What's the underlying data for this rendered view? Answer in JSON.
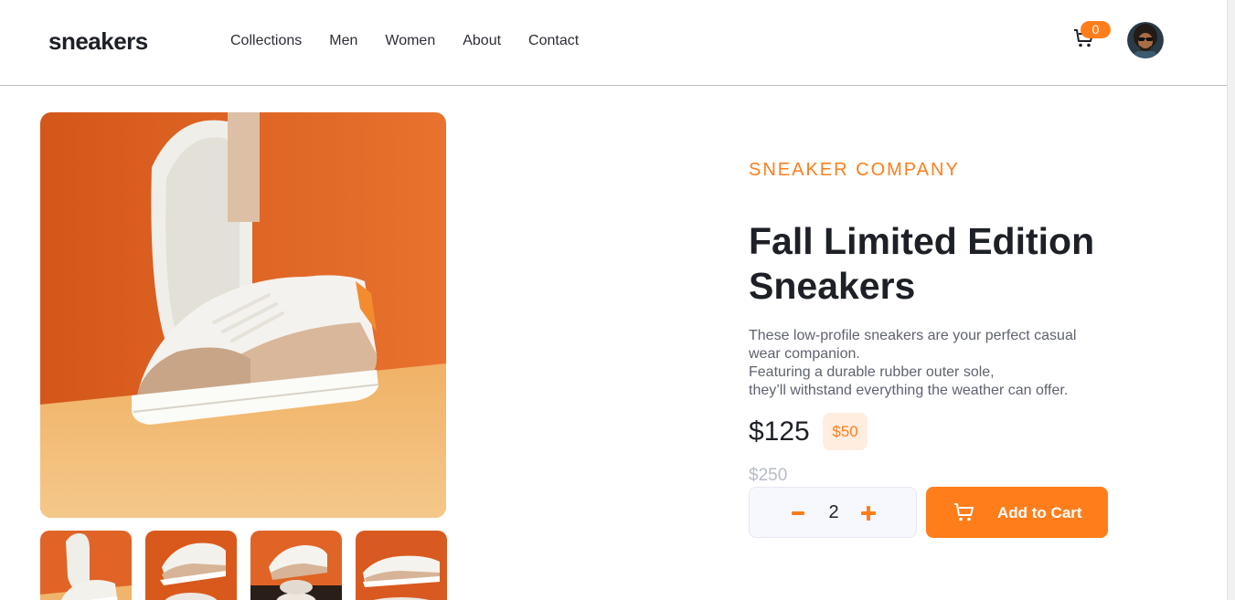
{
  "header": {
    "logo": "sneakers",
    "nav": [
      "Collections",
      "Men",
      "Women",
      "About",
      "Contact"
    ],
    "cart_count": "0"
  },
  "product": {
    "company": "SNEAKER COMPANY",
    "title": "Fall Limited Edition Sneakers",
    "description_lines": [
      "These low-profile sneakers are your perfect casual",
      "wear companion.",
      "Featuring a durable rubber outer sole,",
      "they’ll withstand everything the weather can offer."
    ],
    "price": "$125",
    "discount": "$50",
    "old_price": "$250",
    "quantity": "2",
    "add_to_cart_label": "Add to Cart"
  },
  "colors": {
    "accent": "#ff7e1b",
    "accent_light": "#ffede0",
    "text_dark": "#1d2026",
    "text_muted": "#5f6370"
  },
  "icons": {
    "cart": "cart-icon",
    "minus": "minus-icon",
    "plus": "plus-icon"
  }
}
